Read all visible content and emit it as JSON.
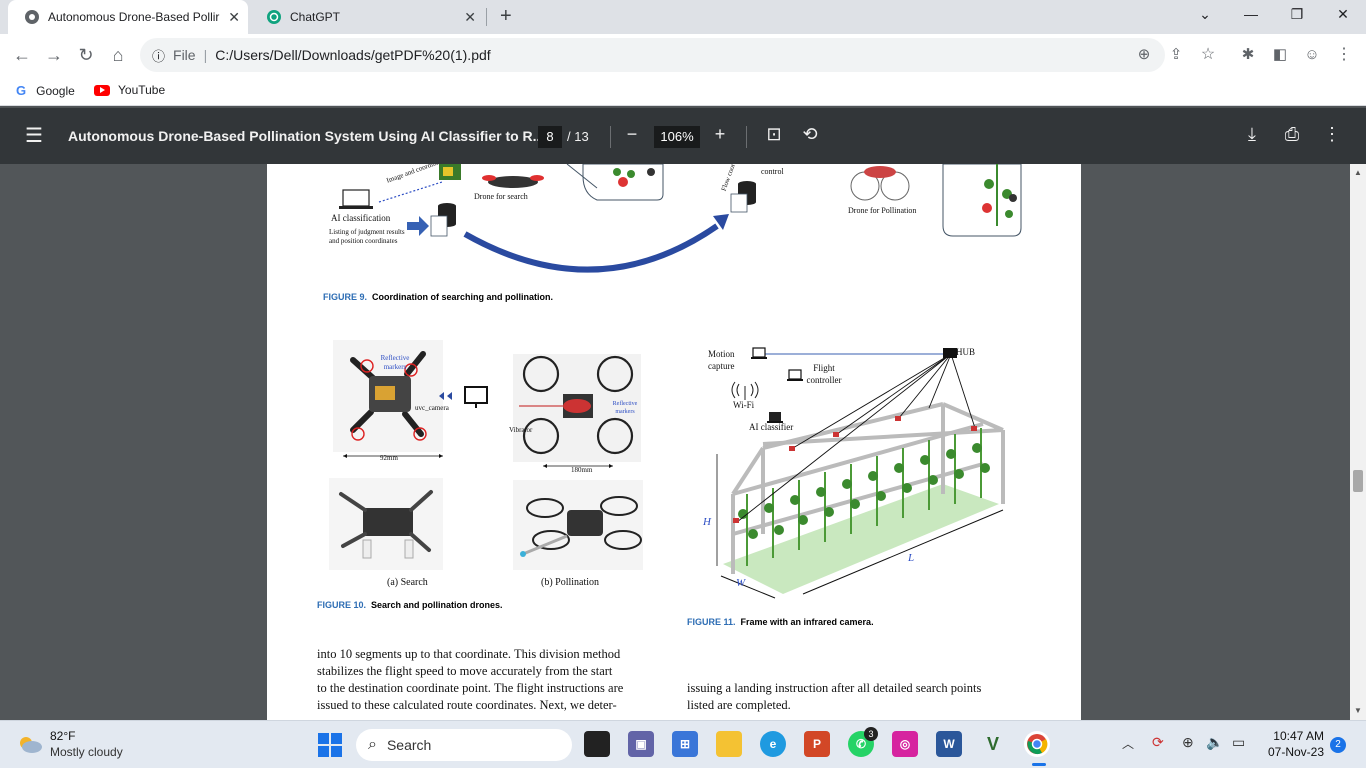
{
  "tabs": [
    {
      "title": "Autonomous Drone-Based Pollir",
      "active": true
    },
    {
      "title": "ChatGPT",
      "active": false
    }
  ],
  "address": {
    "scheme_label": "File",
    "url": "C:/Users/Dell/Downloads/getPDF%20(1).pdf"
  },
  "bookmarks": [
    {
      "label": "Google"
    },
    {
      "label": "YouTube"
    }
  ],
  "pdf_toolbar": {
    "title": "Autonomous Drone-Based Pollination System Using AI Classifier to R...",
    "page_current": "8",
    "page_total": "/ 13",
    "zoom": "106%"
  },
  "figure9": {
    "labels": {
      "image_coords": "Image and coordinates",
      "drone_search": "Drone for search",
      "ai_class": "AI classification",
      "listing": "Listing of judgment results and position coordinates",
      "flow_coords": "Flow coordi...",
      "control": "control",
      "drone_poll": "Drone for Pollination"
    },
    "caption_num": "FIGURE 9.",
    "caption_text": "Coordination of searching and pollination."
  },
  "figure10": {
    "reflective": "Reflective markers",
    "reflective2": "Reflective markers",
    "uvc": "uvc_camera",
    "vibrator": "Vibrator",
    "dim_a": "92mm",
    "dim_b": "180mm",
    "sub_a": "(a) Search",
    "sub_b": "(b) Pollination",
    "caption_num": "FIGURE 10.",
    "caption_text": "Search and pollination drones."
  },
  "figure11": {
    "motion": "Motion capture",
    "hub": "HUB",
    "flight": "Flight controller",
    "wifi": "Wi-Fi",
    "ai": "AI classifier",
    "h": "H",
    "l": "L",
    "w": "W",
    "caption_num": "FIGURE 11.",
    "caption_text": "Frame with an infrared camera."
  },
  "body_left": [
    "into 10 segments up to that coordinate. This division method",
    "stabilizes the flight speed to move accurately from the start",
    "to the destination coordinate point. The flight instructions are",
    "issued to these calculated route coordinates. Next, we deter-"
  ],
  "body_right": [
    "issuing a landing instruction after all detailed search points",
    "listed are completed."
  ],
  "taskbar": {
    "weather_temp": "82°F",
    "weather_desc": "Mostly cloudy",
    "search": "Search",
    "whatsapp_badge": "3",
    "time": "10:47 AM",
    "date": "07-Nov-23",
    "notif": "2"
  },
  "colors": {
    "pdf_toolbar": "#323639",
    "viewer_bg": "#525659",
    "caption_blue": "#2d6db4",
    "taskbar": "#e3e9f1"
  }
}
